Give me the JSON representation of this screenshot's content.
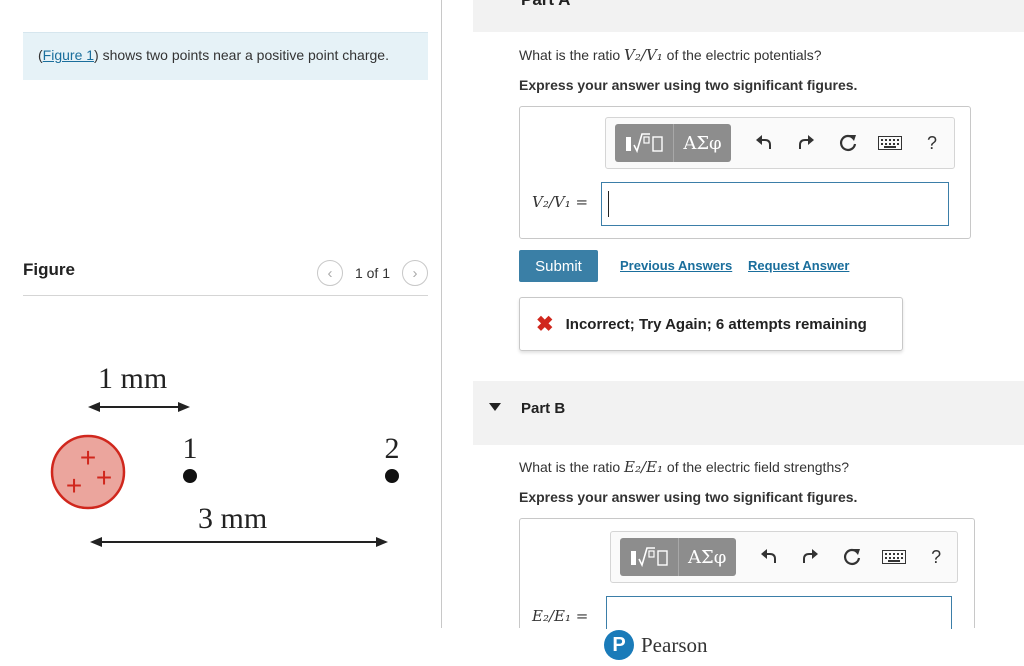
{
  "left": {
    "intro": {
      "prefix": "(",
      "link": "Figure 1",
      "suffix": ") shows two points near a positive point charge."
    },
    "figure": {
      "title": "Figure",
      "pager_count": "1 of 1",
      "prev_icon": "chevron-left-icon",
      "next_icon": "chevron-right-icon",
      "label_1mm": "1 mm",
      "label_3mm": "3 mm",
      "point1": "1",
      "point2": "2",
      "charge_signs": [
        "+",
        "+",
        "+"
      ]
    }
  },
  "part_a": {
    "header_partial": "Part A",
    "question_prefix": "What is the ratio ",
    "question_math": "V₂/V₁",
    "question_suffix": " of the electric potentials?",
    "instruction": "Express your answer using two significant figures.",
    "answer_label": "V₂/V₁ =",
    "answer_value": "",
    "toolbar": {
      "template_icon": "template-sqrt-icon",
      "symbols_label": "ΑΣφ",
      "undo_icon": "undo-icon",
      "redo_icon": "redo-icon",
      "reset_icon": "reset-icon",
      "keyboard_icon": "keyboard-icon",
      "help_label": "?"
    },
    "submit_label": "Submit",
    "previous_answers_label": "Previous Answers",
    "request_answer_label": "Request Answer",
    "feedback": {
      "icon": "x-icon",
      "text": "Incorrect; Try Again; 6 attempts remaining",
      "color": "#d0271d"
    }
  },
  "part_b": {
    "title": "Part B",
    "question_prefix": "What is the ratio ",
    "question_math": "E₂/E₁",
    "question_suffix": " of the electric field strengths?",
    "instruction": "Express your answer using two significant figures.",
    "answer_label": "E₂/E₁ =",
    "answer_value": "",
    "toolbar": {
      "symbols_label": "ΑΣφ",
      "help_label": "?"
    }
  },
  "footer": {
    "logo_letter": "P",
    "brand": "Pearson"
  },
  "colors": {
    "accent": "#3a7fa6",
    "link": "#1a6e9c",
    "intro_bg": "#e6f2f7",
    "charge_fill": "#eba59d",
    "charge_stroke": "#d0271d"
  }
}
